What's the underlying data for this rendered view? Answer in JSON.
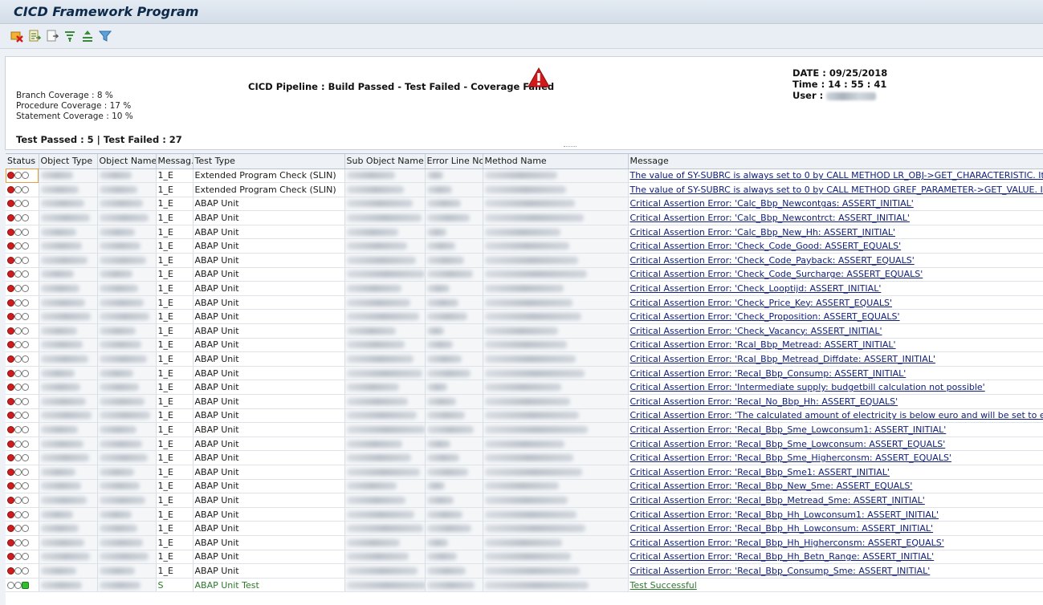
{
  "window": {
    "title": "CICD Framework Program"
  },
  "toolbar": {
    "icons": [
      "delete-icon",
      "export-icon",
      "export-alt-icon",
      "filter-icon",
      "sort-icon",
      "funnel-icon"
    ]
  },
  "header": {
    "branch_coverage": "Branch Coverage : 8 %",
    "procedure_coverage": "Procedure Coverage : 17 %",
    "statement_coverage": "Statement Coverage : 10 %",
    "pipeline_status": "CICD Pipeline : Build Passed - Test Failed - Coverage Failed",
    "date": "DATE : 09/25/2018",
    "time": "Time : 14 : 55 : 41",
    "user_label": "User :",
    "test_counts": "Test Passed : 5 | Test Failed : 27",
    "colors": {
      "warning": "#d11a1a",
      "link": "#10207a",
      "success": "#2b7a2b"
    }
  },
  "grid": {
    "columns": [
      "Status",
      "Object Type",
      "Object Name",
      "Messag...",
      "Test Type",
      "Sub Object Name",
      "Error Line No",
      "Method Name",
      "Message"
    ],
    "rows": [
      {
        "status": "red",
        "msgtype": "1_E",
        "test_type": "Extended Program Check (SLIN)",
        "message": "The value of SY-SUBRC is always set to 0 by CALL METHOD LR_OBJ->GET_CHARACTERISTIC. It is"
      },
      {
        "status": "red",
        "msgtype": "1_E",
        "test_type": "Extended Program Check (SLIN)",
        "message": "The value of SY-SUBRC is always set to 0 by CALL METHOD GREF_PARAMETER->GET_VALUE. It is"
      },
      {
        "status": "red",
        "msgtype": "1_E",
        "test_type": "ABAP Unit",
        "message": "Critical Assertion Error: 'Calc_Bbp_Newcontgas: ASSERT_INITIAL'"
      },
      {
        "status": "red",
        "msgtype": "1_E",
        "test_type": "ABAP Unit",
        "message": "Critical Assertion Error: 'Calc_Bbp_Newcontrct: ASSERT_INITIAL'"
      },
      {
        "status": "red",
        "msgtype": "1_E",
        "test_type": "ABAP Unit",
        "message": "Critical Assertion Error: 'Calc_Bbp_New_Hh: ASSERT_INITIAL'"
      },
      {
        "status": "red",
        "msgtype": "1_E",
        "test_type": "ABAP Unit",
        "message": "Critical Assertion Error: 'Check_Code_Good: ASSERT_EQUALS'"
      },
      {
        "status": "red",
        "msgtype": "1_E",
        "test_type": "ABAP Unit",
        "message": "Critical Assertion Error: 'Check_Code_Payback: ASSERT_EQUALS'"
      },
      {
        "status": "red",
        "msgtype": "1_E",
        "test_type": "ABAP Unit",
        "message": "Critical Assertion Error: 'Check_Code_Surcharge: ASSERT_EQUALS'"
      },
      {
        "status": "red",
        "msgtype": "1_E",
        "test_type": "ABAP Unit",
        "message": "Critical Assertion Error: 'Check_Looptijd: ASSERT_INITIAL'"
      },
      {
        "status": "red",
        "msgtype": "1_E",
        "test_type": "ABAP Unit",
        "message": "Critical Assertion Error: 'Check_Price_Key: ASSERT_EQUALS'"
      },
      {
        "status": "red",
        "msgtype": "1_E",
        "test_type": "ABAP Unit",
        "message": "Critical Assertion Error: 'Check_Proposition: ASSERT_EQUALS'"
      },
      {
        "status": "red",
        "msgtype": "1_E",
        "test_type": "ABAP Unit",
        "message": "Critical Assertion Error: 'Check_Vacancy: ASSERT_INITIAL'"
      },
      {
        "status": "red",
        "msgtype": "1_E",
        "test_type": "ABAP Unit",
        "message": "Critical Assertion Error: 'Rcal_Bbp_Metread: ASSERT_INITIAL'"
      },
      {
        "status": "red",
        "msgtype": "1_E",
        "test_type": "ABAP Unit",
        "message": "Critical Assertion Error: 'Rcal_Bbp_Metread_Diffdate: ASSERT_INITIAL'"
      },
      {
        "status": "red",
        "msgtype": "1_E",
        "test_type": "ABAP Unit",
        "message": "Critical Assertion Error: 'Recal_Bbp_Consump: ASSERT_INITIAL'"
      },
      {
        "status": "red",
        "msgtype": "1_E",
        "test_type": "ABAP Unit",
        "message": "Critical Assertion Error: 'Intermediate supply: budgetbill calculation not possible'"
      },
      {
        "status": "red",
        "msgtype": "1_E",
        "test_type": "ABAP Unit",
        "message": "Critical Assertion Error: 'Recal_No_Bbp_Hh: ASSERT_EQUALS'"
      },
      {
        "status": "red",
        "msgtype": "1_E",
        "test_type": "ABAP Unit",
        "message": "Critical Assertion Error: 'The calculated amount of electricity is below euro and will be set to euro'"
      },
      {
        "status": "red",
        "msgtype": "1_E",
        "test_type": "ABAP Unit",
        "message": "Critical Assertion Error: 'Recal_Bbp_Sme_Lowconsum1: ASSERT_INITIAL'"
      },
      {
        "status": "red",
        "msgtype": "1_E",
        "test_type": "ABAP Unit",
        "message": "Critical Assertion Error: 'Recal_Bbp_Sme_Lowconsum: ASSERT_EQUALS'"
      },
      {
        "status": "red",
        "msgtype": "1_E",
        "test_type": "ABAP Unit",
        "message": "Critical Assertion Error: 'Recal_Bbp_Sme_Higherconsm: ASSERT_EQUALS'"
      },
      {
        "status": "red",
        "msgtype": "1_E",
        "test_type": "ABAP Unit",
        "message": "Critical Assertion Error: 'Recal_Bbp_Sme1: ASSERT_INITIAL'"
      },
      {
        "status": "red",
        "msgtype": "1_E",
        "test_type": "ABAP Unit",
        "message": "Critical Assertion Error: 'Recal_Bbp_New_Sme: ASSERT_EQUALS'"
      },
      {
        "status": "red",
        "msgtype": "1_E",
        "test_type": "ABAP Unit",
        "message": "Critical Assertion Error: 'Recal_Bbp_Metread_Sme: ASSERT_INITIAL'"
      },
      {
        "status": "red",
        "msgtype": "1_E",
        "test_type": "ABAP Unit",
        "message": "Critical Assertion Error: 'Recal_Bbp_Hh_Lowconsum1: ASSERT_INITIAL'"
      },
      {
        "status": "red",
        "msgtype": "1_E",
        "test_type": "ABAP Unit",
        "message": "Critical Assertion Error: 'Recal_Bbp_Hh_Lowconsum: ASSERT_INITIAL'"
      },
      {
        "status": "red",
        "msgtype": "1_E",
        "test_type": "ABAP Unit",
        "message": "Critical Assertion Error: 'Recal_Bbp_Hh_Higherconsm: ASSERT_EQUALS'"
      },
      {
        "status": "red",
        "msgtype": "1_E",
        "test_type": "ABAP Unit",
        "message": "Critical Assertion Error: 'Recal_Bbp_Hh_Betn_Range: ASSERT_INITIAL'"
      },
      {
        "status": "red",
        "msgtype": "1_E",
        "test_type": "ABAP Unit",
        "message": "Critical Assertion Error: 'Recal_Bbp_Consump_Sme: ASSERT_INITIAL'"
      },
      {
        "status": "green",
        "msgtype": "S",
        "test_type": "ABAP Unit Test",
        "message": "Test Successful"
      }
    ]
  }
}
